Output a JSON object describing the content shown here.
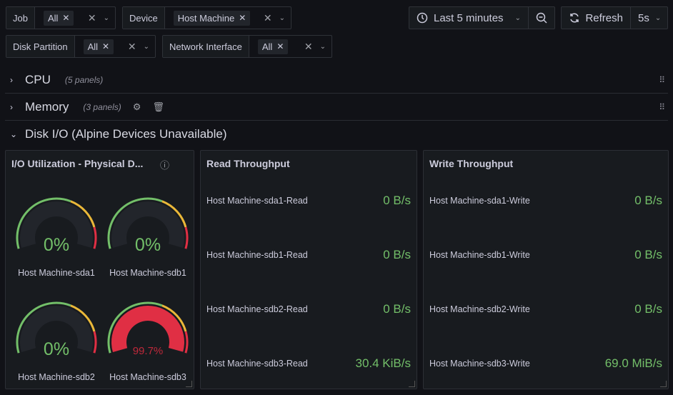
{
  "variables": [
    {
      "label": "Job",
      "value": "All"
    },
    {
      "label": "Device",
      "value": "Host Machine"
    },
    {
      "label": "Disk Partition",
      "value": "All"
    },
    {
      "label": "Network Interface",
      "value": "All"
    }
  ],
  "toolbar": {
    "time_range": "Last 5 minutes",
    "refresh_label": "Refresh",
    "refresh_interval": "5s"
  },
  "rows": [
    {
      "title": "CPU",
      "count": "(5 panels)"
    },
    {
      "title": "Memory",
      "count": "(3 panels)"
    },
    {
      "title": "Disk I/O (Alpine Devices Unavailable)"
    }
  ],
  "colors": {
    "green": "#73bf69",
    "yellow": "#eab839",
    "red": "#e02f44",
    "track": "#22252b"
  },
  "gauge_panel": {
    "title": "I/O Utilization - Physical D...",
    "gauges": [
      {
        "name": "Host Machine-sda1",
        "value": 0,
        "label": "0%"
      },
      {
        "name": "Host Machine-sdb1",
        "value": 0,
        "label": "0%"
      },
      {
        "name": "Host Machine-sdb2",
        "value": 0,
        "label": "0%"
      },
      {
        "name": "Host Machine-sdb3",
        "value": 99.7,
        "label": "99.7%"
      }
    ],
    "thresholds": [
      60,
      85
    ]
  },
  "read_panel": {
    "title": "Read Throughput",
    "stats": [
      {
        "name": "Host Machine-sda1-Read",
        "value": "0 B/s"
      },
      {
        "name": "Host Machine-sdb1-Read",
        "value": "0 B/s"
      },
      {
        "name": "Host Machine-sdb2-Read",
        "value": "0 B/s"
      },
      {
        "name": "Host Machine-sdb3-Read",
        "value": "30.4 KiB/s"
      }
    ]
  },
  "write_panel": {
    "title": "Write Throughput",
    "stats": [
      {
        "name": "Host Machine-sda1-Write",
        "value": "0 B/s"
      },
      {
        "name": "Host Machine-sdb1-Write",
        "value": "0 B/s"
      },
      {
        "name": "Host Machine-sdb2-Write",
        "value": "0 B/s"
      },
      {
        "name": "Host Machine-sdb3-Write",
        "value": "69.0 MiB/s"
      }
    ]
  }
}
